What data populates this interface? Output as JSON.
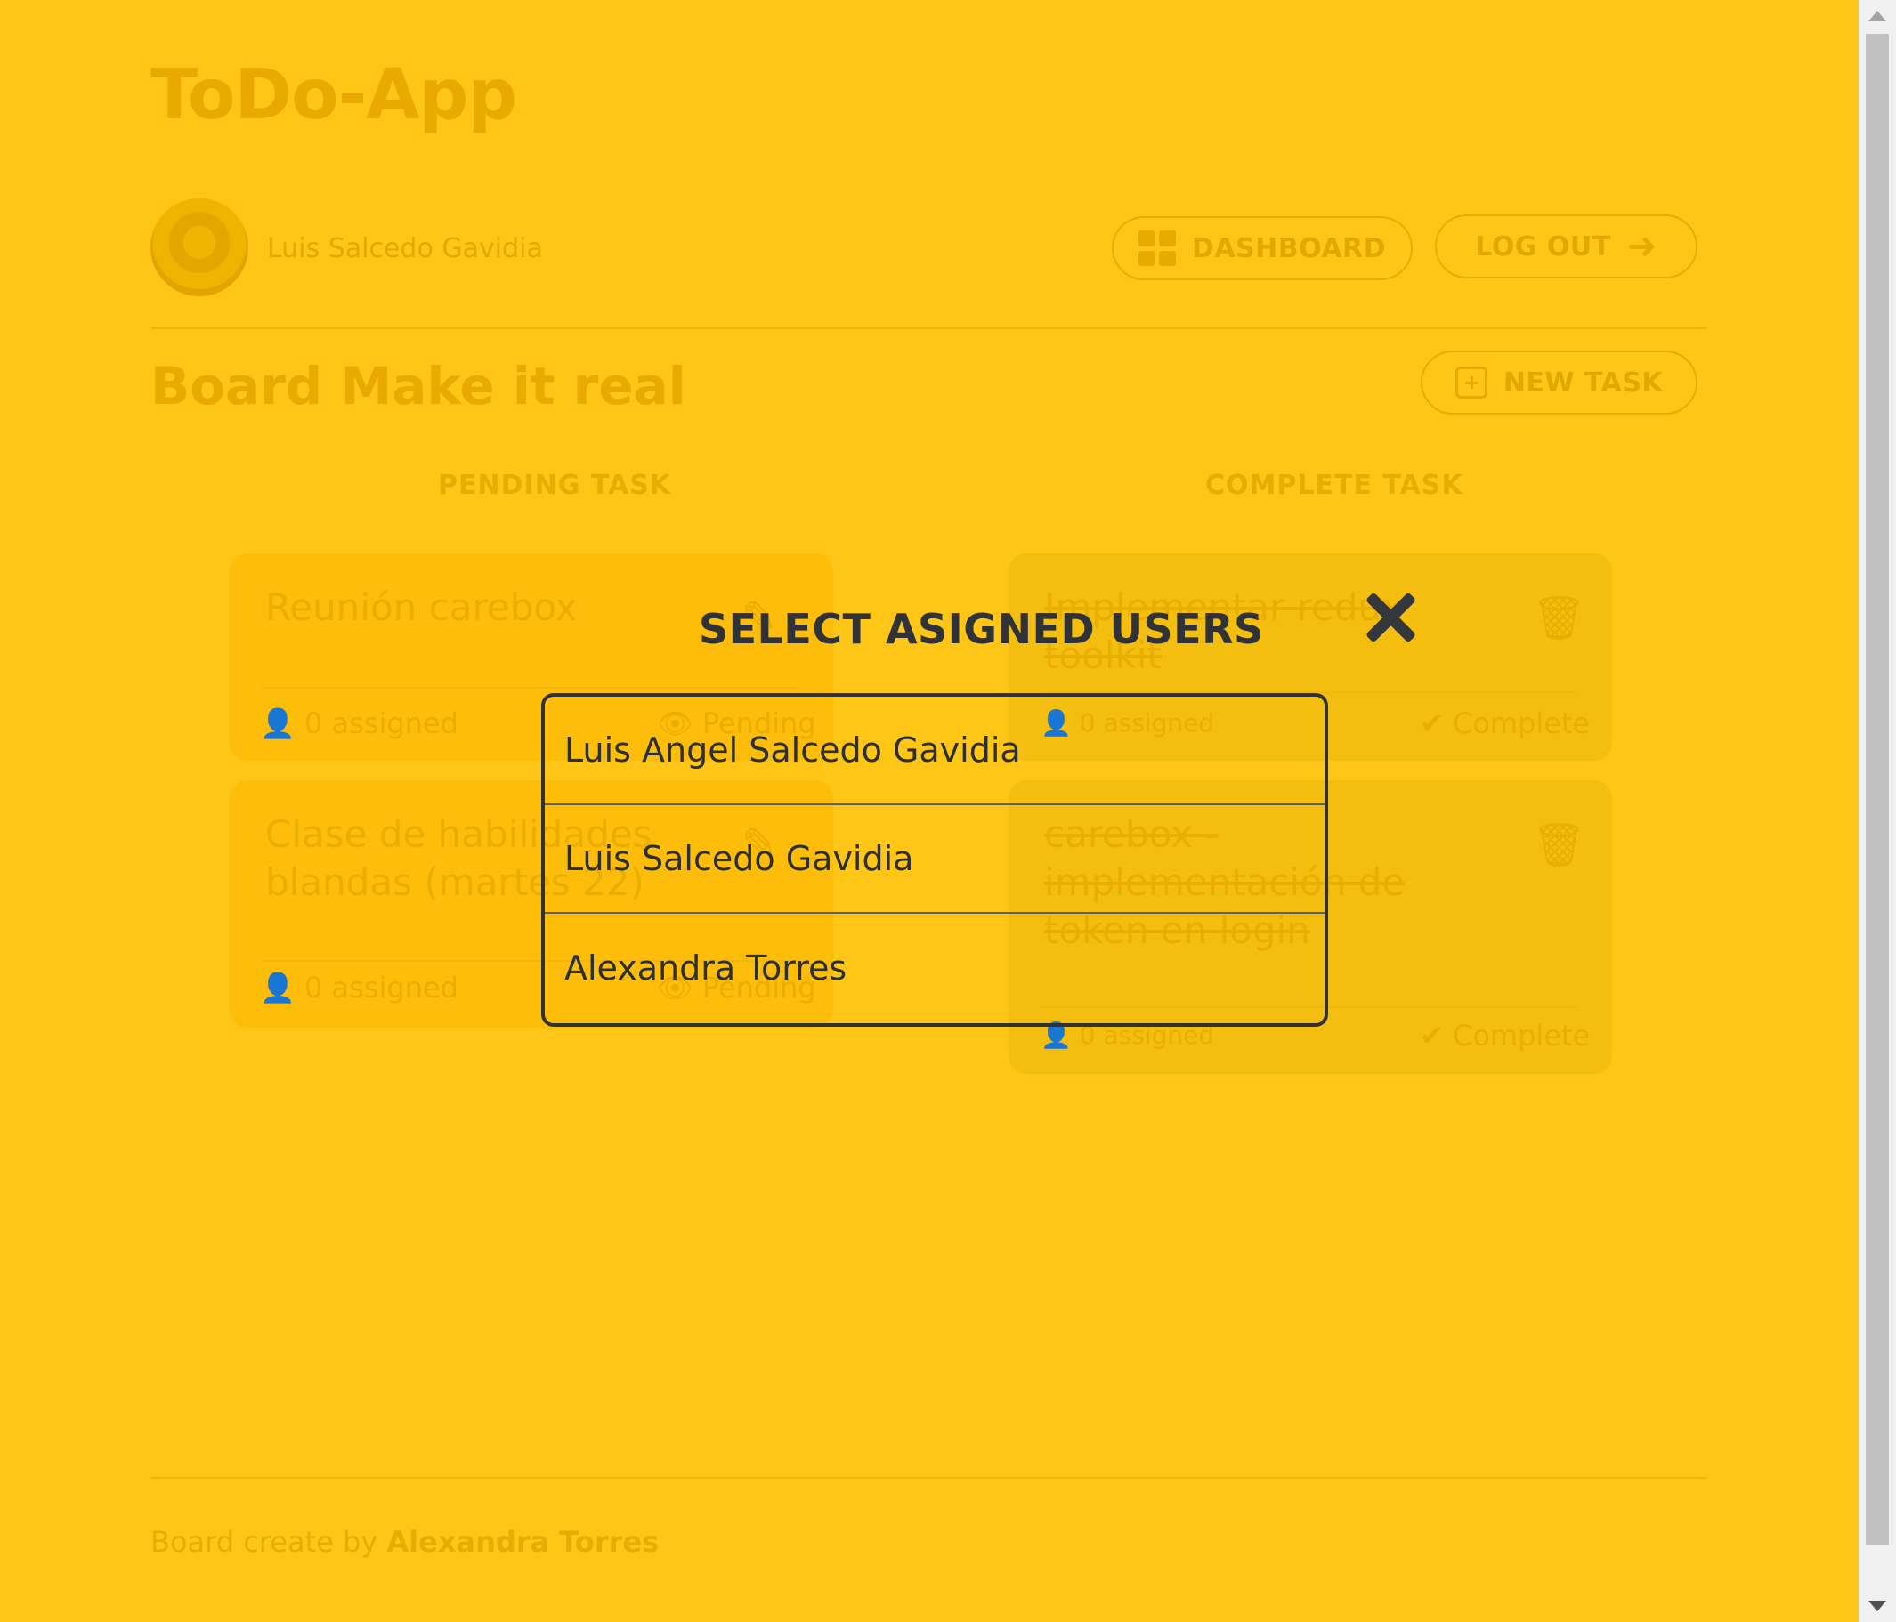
{
  "app": {
    "title": "ToDo-App"
  },
  "user": {
    "name": "Luis Salcedo Gavidia"
  },
  "nav": {
    "dashboard_label": "DASHBOARD",
    "logout_label": "LOG OUT"
  },
  "board": {
    "title": "Board Make it real",
    "new_task_label": "NEW TASK",
    "columns": {
      "pending": "PENDING TASK",
      "complete": "COMPLETE TASK"
    },
    "pending_tasks": [
      {
        "title": "Reunión carebox",
        "assigned": "0 assigned",
        "status": "Pending"
      },
      {
        "title": "Clase de habilidades blandas (martes 22)",
        "assigned": "0 assigned",
        "status": "Pending"
      }
    ],
    "complete_tasks": [
      {
        "title": "Implementar redux toolkit",
        "assigned": "0 assigned",
        "status": "Complete"
      },
      {
        "title": "carebox - implementación de token en login",
        "assigned": "0 assigned",
        "status": "Complete"
      }
    ]
  },
  "footer": {
    "prefix": "Board create by",
    "author": "Alexandra Torres"
  },
  "modal": {
    "title": "SELECT ASIGNED USERS",
    "users": [
      "Luis Angel Salcedo Gavidia",
      "Luis Salcedo Gavidia",
      "Alexandra Torres"
    ]
  }
}
